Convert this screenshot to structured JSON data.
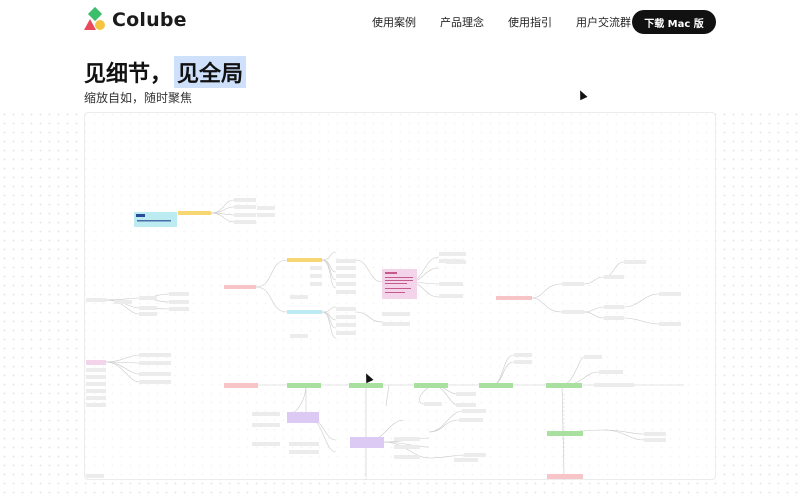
{
  "app": {
    "name": "Colube"
  },
  "nav": {
    "items": [
      "使用案例",
      "产品理念",
      "使用指引",
      "用户交流群"
    ],
    "download_label": "下载 Mac 版"
  },
  "hero": {
    "title_plain": "见细节，",
    "title_highlight": "见全局",
    "subtitle": "缩放自如，随时聚焦"
  },
  "colors": {
    "yellow": "#f7d774",
    "cyan": "#bdebf2",
    "pink": "#f7c4c8",
    "green": "#a9e0a0",
    "purple": "#dccaf5",
    "lightpink": "#f4d4ea",
    "gray": "#f1f1f1",
    "highlight": "#cfe0fb"
  }
}
